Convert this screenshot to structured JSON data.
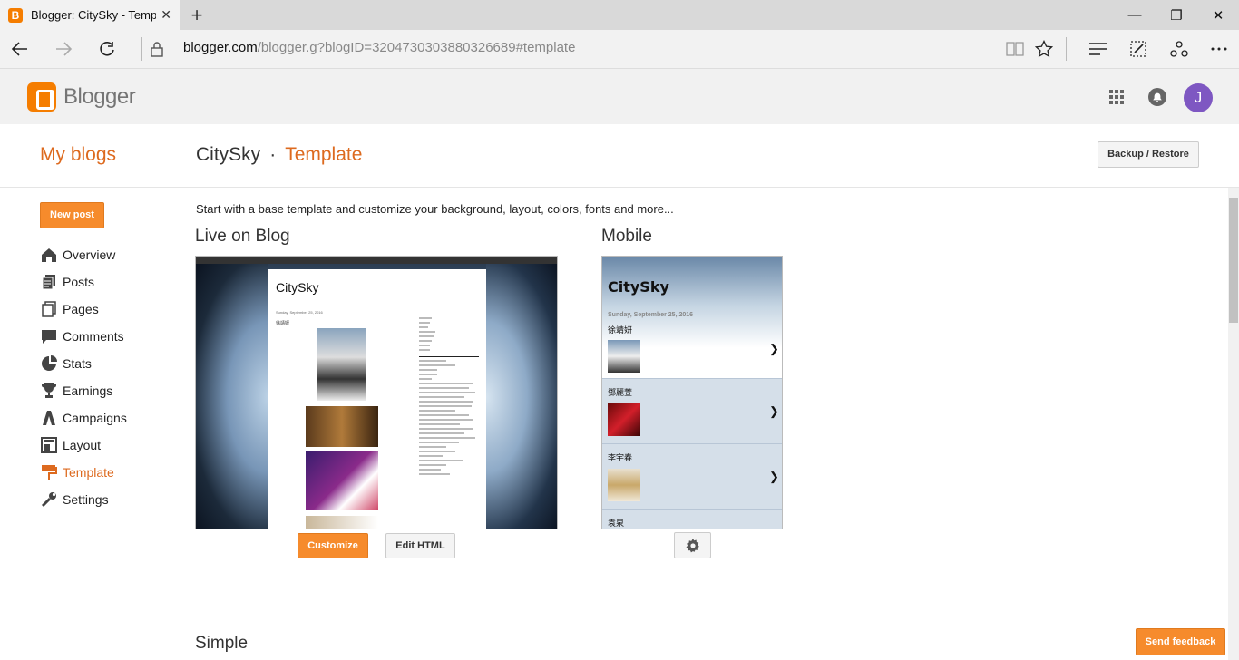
{
  "browser": {
    "tab_title": "Blogger: CitySky - Temp",
    "tab_favicon": "B",
    "url_host": "blogger.com",
    "url_path": "/blogger.g?blogID=3204730303880326689#template",
    "minimize": "—",
    "restore": "❐",
    "close": "✕",
    "new_tab": "+"
  },
  "header": {
    "brand": "Blogger",
    "avatar_letter": "J"
  },
  "page": {
    "my_blogs": "My blogs",
    "blog_name": "CitySky",
    "separator": "·",
    "section": "Template",
    "backup_button": "Backup / Restore",
    "new_post": "New post",
    "intro": "Start with a base template and customize your background, layout, colors, fonts and more...",
    "live_heading": "Live on Blog",
    "mobile_heading": "Mobile",
    "simple_heading": "Simple",
    "customize_button": "Customize",
    "edit_html_button": "Edit HTML",
    "send_feedback": "Send feedback"
  },
  "sidebar": {
    "items": [
      {
        "label": "Overview",
        "icon": "overview-icon"
      },
      {
        "label": "Posts",
        "icon": "posts-icon"
      },
      {
        "label": "Pages",
        "icon": "pages-icon"
      },
      {
        "label": "Comments",
        "icon": "comments-icon"
      },
      {
        "label": "Stats",
        "icon": "stats-icon"
      },
      {
        "label": "Earnings",
        "icon": "earnings-icon"
      },
      {
        "label": "Campaigns",
        "icon": "campaigns-icon"
      },
      {
        "label": "Layout",
        "icon": "layout-icon"
      },
      {
        "label": "Template",
        "icon": "template-icon",
        "active": true
      },
      {
        "label": "Settings",
        "icon": "settings-icon"
      }
    ]
  },
  "desktop_preview": {
    "title": "CitySky",
    "date": "Sunday, September 25, 2016",
    "post_title": "徐靖妍"
  },
  "mobile_preview": {
    "title": "CitySky",
    "date": "Sunday, September 25, 2016",
    "posts": [
      "徐靖妍",
      "鄧麗萱",
      "李宇春",
      "袁泉"
    ],
    "arrow": "❯"
  },
  "colors": {
    "accent": "#dd6a1f",
    "button": "#f68b2c",
    "avatar": "#7e57c2"
  }
}
